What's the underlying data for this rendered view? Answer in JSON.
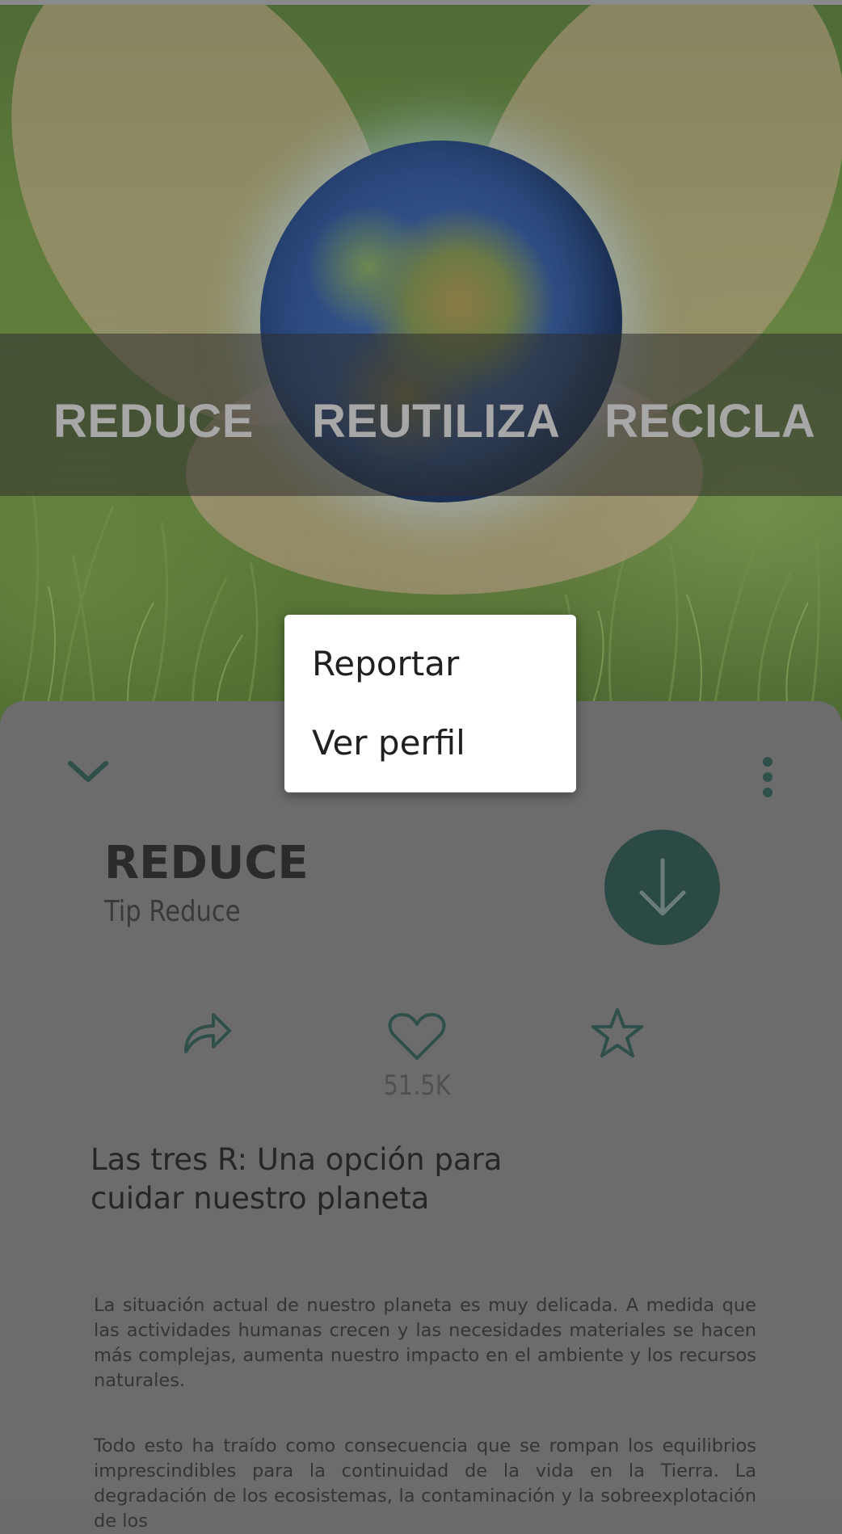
{
  "hero": {
    "words": [
      "REDUCE",
      "REUTILIZA",
      "RECICLA"
    ]
  },
  "sheet": {
    "collapse_icon": "chevron-down-icon",
    "more_icon": "more-vertical-icon",
    "title": "REDUCE",
    "subtitle": "Tip Reduce",
    "download_icon": "arrow-down-icon",
    "actions": {
      "share_icon": "share-icon",
      "like_icon": "heart-icon",
      "like_count": "51.5K",
      "favorite_icon": "star-icon"
    },
    "headline": "Las tres R: Una opción para cuidar nuestro planeta",
    "paragraphs": [
      "La situación actual de nuestro planeta es muy delicada. A medida que las actividades humanas crecen y las necesidades materiales se hacen más complejas, aumenta nuestro impacto en el ambiente y los recursos naturales.",
      "Todo esto ha traído como consecuencia que se rompan los equilibrios imprescindibles para la continuidad de la vida en la Tierra. La degradación de los ecosistemas, la contaminación y la sobreexplotación de los"
    ]
  },
  "menu": {
    "items": [
      "Reportar",
      "Ver perfil"
    ]
  },
  "colors": {
    "accent": "#2b4a46",
    "icon": "#2f4f4a",
    "scrim_sheet": "#6c6c6c",
    "band_text": "#a7a7a7"
  }
}
